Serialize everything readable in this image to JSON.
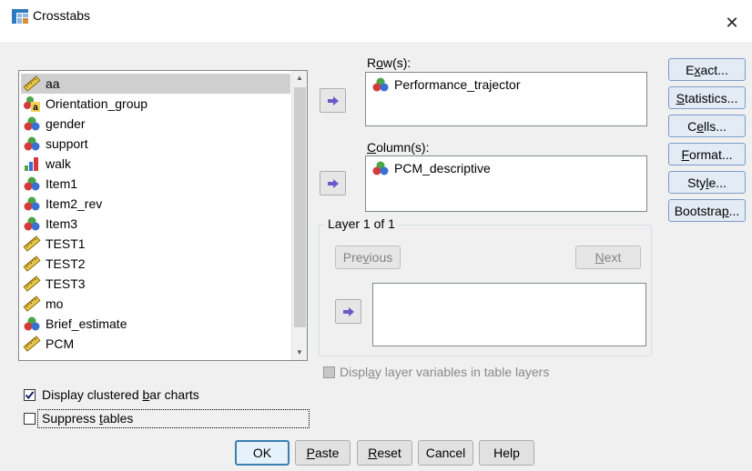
{
  "window": {
    "title": "Crosstabs",
    "close_glyph": "✕"
  },
  "variables": [
    {
      "name": "aa",
      "icon": "ruler-icon",
      "selected": true
    },
    {
      "name": "Orientation_group",
      "icon": "nominal-string-icon"
    },
    {
      "name": "gender",
      "icon": "nominal-icon"
    },
    {
      "name": "support",
      "icon": "nominal-icon"
    },
    {
      "name": "walk",
      "icon": "ordinal-icon"
    },
    {
      "name": "Item1",
      "icon": "nominal-icon"
    },
    {
      "name": "Item2_rev",
      "icon": "nominal-icon"
    },
    {
      "name": "Item3",
      "icon": "nominal-icon"
    },
    {
      "name": "TEST1",
      "icon": "ruler-icon"
    },
    {
      "name": "TEST2",
      "icon": "ruler-icon"
    },
    {
      "name": "TEST3",
      "icon": "ruler-icon"
    },
    {
      "name": "mo",
      "icon": "ruler-icon"
    },
    {
      "name": "Brief_estimate",
      "icon": "nominal-icon"
    },
    {
      "name": "PCM",
      "icon": "ruler-icon"
    }
  ],
  "rows": {
    "label_pre": "R",
    "label_u": "o",
    "label_post": "w(s):",
    "value": "Performance_trajector"
  },
  "columns": {
    "label_pre": "",
    "label_u": "C",
    "label_post": "olumn(s):",
    "value": "PCM_descriptive"
  },
  "layer": {
    "title": "Layer 1 of 1",
    "previous": {
      "pre": "Pre",
      "u": "v",
      "post": "ious"
    },
    "next": {
      "pre": "",
      "u": "N",
      "post": "ext"
    }
  },
  "side_buttons": {
    "exact": {
      "pre": "E",
      "u": "x",
      "post": "act..."
    },
    "statistics": {
      "pre": "",
      "u": "S",
      "post": "tatistics..."
    },
    "cells": {
      "pre": "C",
      "u": "e",
      "post": "lls..."
    },
    "format": {
      "pre": "",
      "u": "F",
      "post": "ormat..."
    },
    "style": {
      "pre": "Sty",
      "u": "l",
      "post": "e..."
    },
    "bootstrap": {
      "pre": "Bootstra",
      "u": "p",
      "post": "..."
    }
  },
  "options": {
    "display_layer": {
      "pre": "Displ",
      "u": "a",
      "post": "y layer variables in table layers",
      "checked": false,
      "disabled": true
    },
    "clustered": {
      "pre": "Display clustered ",
      "u": "b",
      "post": "ar charts",
      "checked": true
    },
    "suppress": {
      "pre": "Suppress ",
      "u": "t",
      "post": "ables",
      "checked": false
    }
  },
  "footer": {
    "ok": "OK",
    "paste": {
      "pre": "",
      "u": "P",
      "post": "aste"
    },
    "reset": {
      "pre": "",
      "u": "R",
      "post": "eset"
    },
    "cancel": "Cancel",
    "help": "Help"
  },
  "colors": {
    "accent_blue": "#3c7fb1",
    "arrow_purple": "#6c58c8",
    "title_icon_blue": "#2c7bc0"
  }
}
